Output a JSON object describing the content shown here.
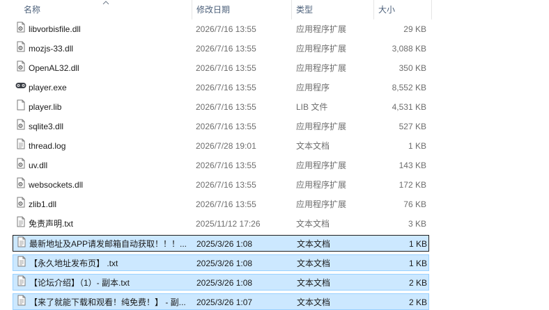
{
  "columns": {
    "name": "名称",
    "date": "修改日期",
    "type": "类型",
    "size": "大小"
  },
  "files": [
    {
      "name": "libvorbisfile.dll",
      "date": "2026/7/16 13:55",
      "type": "应用程序扩展",
      "size": "29 KB",
      "icon": "dll-file-icon"
    },
    {
      "name": "mozjs-33.dll",
      "date": "2026/7/16 13:55",
      "type": "应用程序扩展",
      "size": "3,088 KB",
      "icon": "dll-file-icon"
    },
    {
      "name": "OpenAL32.dll",
      "date": "2026/7/16 13:55",
      "type": "应用程序扩展",
      "size": "350 KB",
      "icon": "dll-file-icon"
    },
    {
      "name": "player.exe",
      "date": "2026/7/16 13:55",
      "type": "应用程序",
      "size": "8,552 KB",
      "icon": "gamepad-exe-icon"
    },
    {
      "name": "player.lib",
      "date": "2026/7/16 13:55",
      "type": "LIB 文件",
      "size": "4,531 KB",
      "icon": "blank-file-icon"
    },
    {
      "name": "sqlite3.dll",
      "date": "2026/7/16 13:55",
      "type": "应用程序扩展",
      "size": "527 KB",
      "icon": "dll-file-icon"
    },
    {
      "name": "thread.log",
      "date": "2026/7/28 19:01",
      "type": "文本文档",
      "size": "1 KB",
      "icon": "text-file-icon"
    },
    {
      "name": "uv.dll",
      "date": "2026/7/16 13:55",
      "type": "应用程序扩展",
      "size": "143 KB",
      "icon": "dll-file-icon"
    },
    {
      "name": "websockets.dll",
      "date": "2026/7/16 13:55",
      "type": "应用程序扩展",
      "size": "172 KB",
      "icon": "dll-file-icon"
    },
    {
      "name": "zlib1.dll",
      "date": "2026/7/16 13:55",
      "type": "应用程序扩展",
      "size": "76 KB",
      "icon": "dll-file-icon"
    },
    {
      "name": "免责声明.txt",
      "date": "2025/11/12 17:26",
      "type": "文本文档",
      "size": "3 KB",
      "icon": "text-file-icon"
    },
    {
      "name": "最新地址及APP请发邮箱自动获取！！！...",
      "date": "2025/3/26 1:08",
      "type": "文本文档",
      "size": "1 KB",
      "icon": "text-file-icon",
      "selected": true,
      "focused": true
    },
    {
      "name": "【永久地址发布页】 .txt",
      "date": "2025/3/26 1:08",
      "type": "文本文档",
      "size": "1 KB",
      "icon": "text-file-icon",
      "selected": true
    },
    {
      "name": "【论坛介绍】（1）- 副本.txt",
      "date": "2025/3/26 1:08",
      "type": "文本文档",
      "size": "2 KB",
      "icon": "text-file-icon",
      "selected": true
    },
    {
      "name": "【来了就能下载和观看！纯免费！】 - 副...",
      "date": "2025/3/26 1:07",
      "type": "文本文档",
      "size": "2 KB",
      "icon": "text-file-icon",
      "selected": true
    }
  ]
}
